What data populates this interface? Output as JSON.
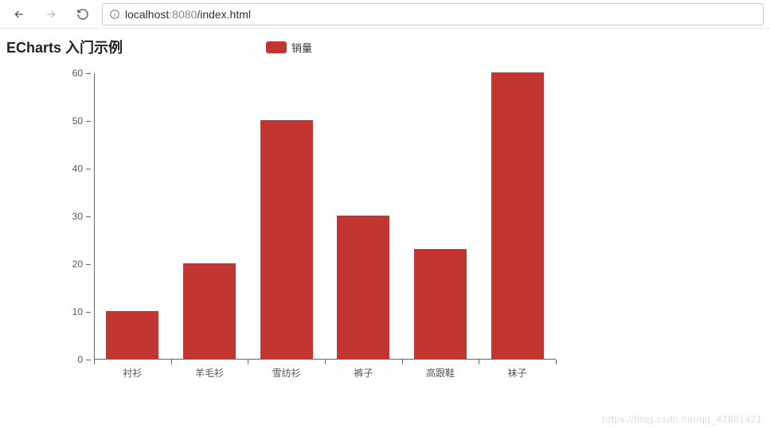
{
  "browser": {
    "url_host": "localhost",
    "url_port": ":8080",
    "url_path": "/index.html"
  },
  "chart_data": {
    "type": "bar",
    "title": "ECharts 入门示例",
    "xlabel": "",
    "ylabel": "",
    "ylim": [
      0,
      60
    ],
    "y_ticks": [
      0,
      10,
      20,
      30,
      40,
      50,
      60
    ],
    "categories": [
      "衬衫",
      "羊毛衫",
      "雪纺衫",
      "裤子",
      "高跟鞋",
      "袜子"
    ],
    "series": [
      {
        "name": "销量",
        "values": [
          10,
          20,
          50,
          30,
          23,
          60
        ]
      }
    ],
    "legend_position": "top",
    "grid": false,
    "bar_color": "#c23531"
  },
  "watermark": "https://blog.csdn.net/qq_42881421"
}
